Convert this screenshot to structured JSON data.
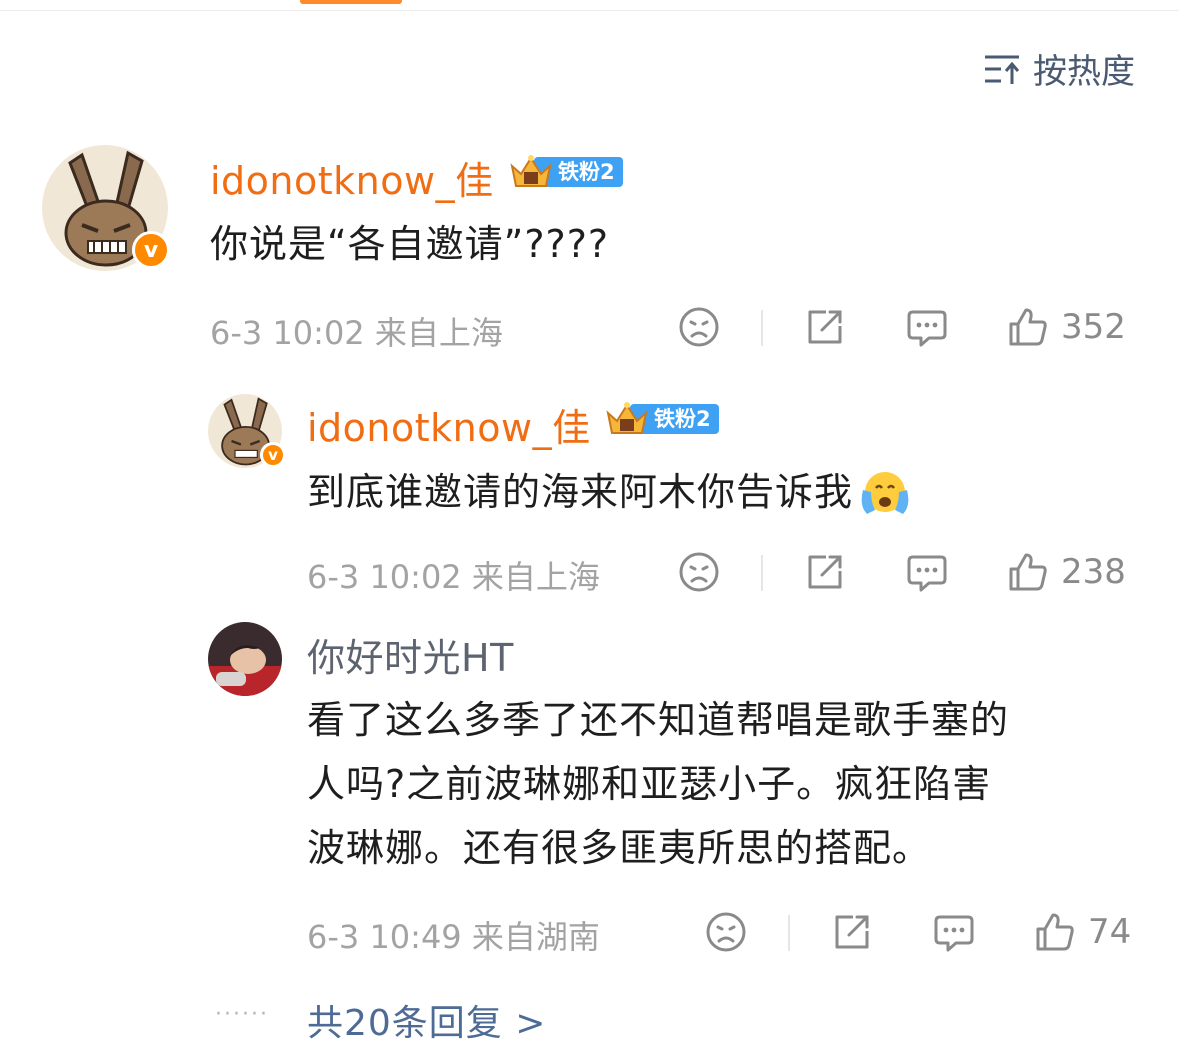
{
  "sort": {
    "label": "按热度",
    "icon": "sort-icon"
  },
  "colors": {
    "accent": "#f06d14",
    "link": "#4e6b95",
    "fan_badge": "#3fa1f3",
    "muted": "#a3a3a3"
  },
  "comments": [
    {
      "username": "idonotknow_佳",
      "fan_badge": "铁粉2",
      "content": "你说是“各自邀请”????",
      "time": "6-3 10:02",
      "location": "来自上海",
      "like_count": "352"
    },
    {
      "username": "idonotknow_佳",
      "fan_badge": "铁粉2",
      "content": "到底谁邀请的海来阿木你告诉我",
      "emoji": "crying-face",
      "time": "6-3 10:02",
      "location": "来自上海",
      "like_count": "238"
    },
    {
      "username": "你好时光HT",
      "content_lines": [
        "看了这么多季了还不知道帮唱是歌手塞的",
        "人吗?之前波琳娜和亚瑟小子。疯狂陷害",
        "波琳娜。还有很多匪夷所思的搭配。"
      ],
      "time": "6-3 10:49",
      "location": "来自湖南",
      "like_count": "74"
    }
  ],
  "more_replies": {
    "dots": "······",
    "label": "共20条回复 >"
  }
}
